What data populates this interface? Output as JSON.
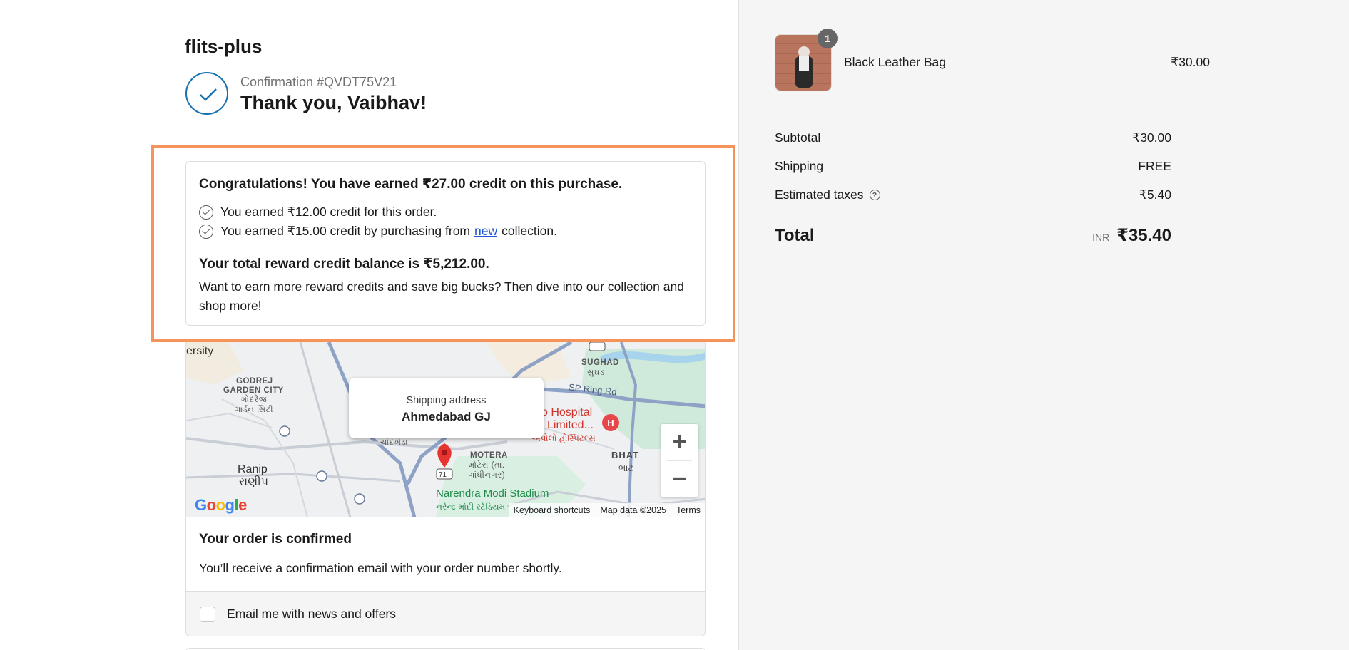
{
  "shop": {
    "name": "flits-plus"
  },
  "confirmation": {
    "number": "Confirmation #QVDT75V21",
    "thank_you": "Thank you, Vaibhav!"
  },
  "reward": {
    "title": "Congratulations! You have earned ₹27.00 credit on this purchase.",
    "line1": "You earned ₹12.00 credit for this order.",
    "line2_prefix": "You earned ₹15.00 credit by purchasing from",
    "line2_link": "new",
    "line2_suffix": "collection.",
    "balance": "Your total reward credit balance is ₹5,212.00.",
    "promo": "Want to earn more reward credits and save big bucks? Then dive into our collection and shop more!"
  },
  "map": {
    "tooltip_label": "Shipping address",
    "tooltip_value": "Ahmedabad GJ",
    "labels": {
      "university": "ersity",
      "godrej": "GODREJ",
      "garden_city": "GARDEN CITY",
      "garden_city_guj": "ગોદરેજ ગાર્ડન સિટી",
      "sughad": "SUGHAD",
      "sughad_guj": "સુઘડ",
      "ring_road": "SP Ring Rd",
      "hospital": "o Hospital",
      "hospital2": "Limited...",
      "hospital_guj": "અપોલો હોસ્પિટલ્સ",
      "chandkheda_guj": "ચાંદખેડા",
      "motera": "MOTERA",
      "motera_guj": "મોટેરા (તા. ગાંધીનગર)",
      "bhat": "BHAT",
      "bhat_guj": "ભાટ",
      "ranip": "Ranip",
      "ranip_guj": "રાણીપ",
      "stadium": "Narendra Modi Stadium",
      "stadium_guj": "નરેન્દ્ર મોદી સ્ટેડિયમ",
      "route": "71"
    },
    "zoom_in": "+",
    "zoom_out": "−",
    "logo": "Google",
    "footer": {
      "shortcuts": "Keyboard shortcuts",
      "data": "Map data ©2025",
      "terms": "Terms"
    }
  },
  "order": {
    "title": "Your order is confirmed",
    "text": "You’ll receive a confirmation email with your order number shortly."
  },
  "newsletter": {
    "label": "Email me with news and offers",
    "checked": false
  },
  "summary": {
    "product": {
      "name": "Black Leather Bag",
      "price": "₹30.00",
      "quantity": "1"
    },
    "subtotal_label": "Subtotal",
    "subtotal_value": "₹30.00",
    "shipping_label": "Shipping",
    "shipping_value": "FREE",
    "taxes_label": "Estimated taxes",
    "taxes_help": "?",
    "taxes_value": "₹5.40",
    "total_label": "Total",
    "total_currency": "INR",
    "total_value": "₹35.40"
  },
  "colors": {
    "accent": "#1773b0",
    "highlight": "#f5935a",
    "link": "#1a56d6"
  }
}
